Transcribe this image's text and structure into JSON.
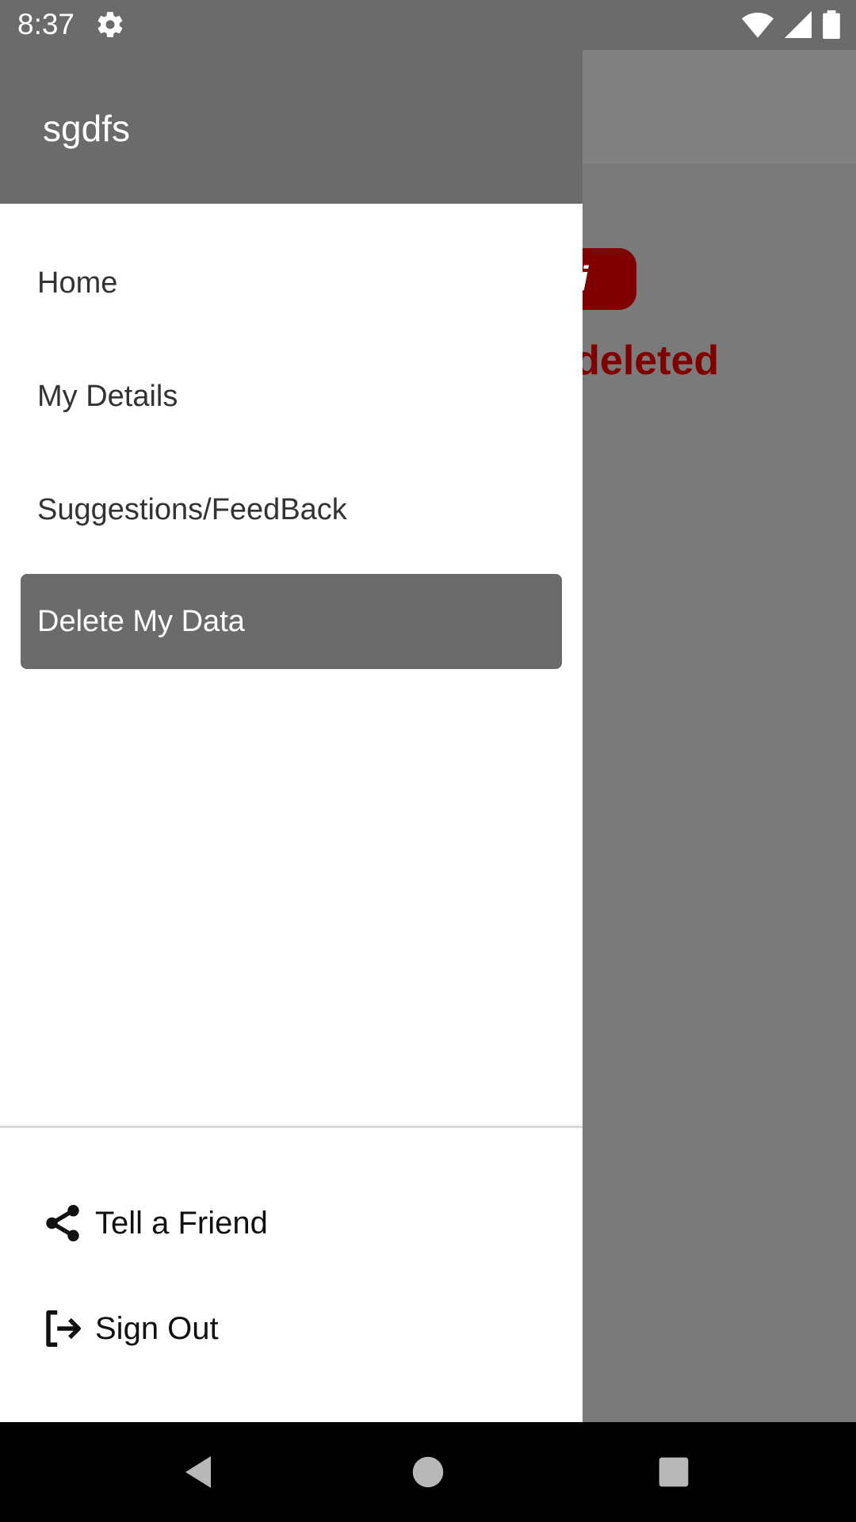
{
  "status_bar": {
    "time": "8:37",
    "icons": [
      "gear-icon",
      "wifi-icon",
      "signal-icon",
      "battery-icon"
    ]
  },
  "background": {
    "partial_text": "be deleted",
    "accent_color": "#800000"
  },
  "drawer": {
    "header_title": "sgdfs",
    "menu_items": [
      {
        "label": "Home",
        "active": false
      },
      {
        "label": "My Details",
        "active": false
      },
      {
        "label": "Suggestions/FeedBack",
        "active": false
      },
      {
        "label": "Delete My Data",
        "active": true
      }
    ],
    "footer_items": [
      {
        "label": "Tell a Friend",
        "icon": "share-icon"
      },
      {
        "label": "Sign Out",
        "icon": "sign-out-icon"
      }
    ],
    "header_color": "#6b6b6b"
  },
  "nav_bar": {
    "buttons": [
      "back-icon",
      "home-icon",
      "recents-icon"
    ]
  }
}
